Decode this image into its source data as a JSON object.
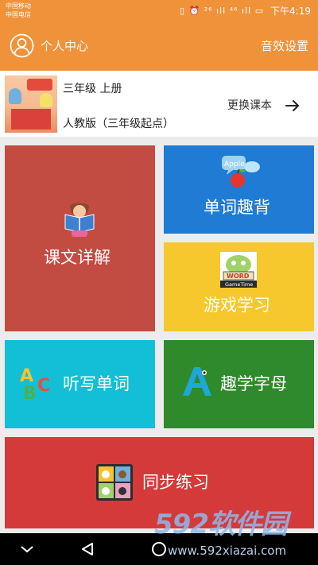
{
  "status_bar": {
    "carrier_1": "中国移动",
    "carrier_2": "中国电信",
    "icons": "▯ ⏰ ²⁶ ıll ⁴⁶ ıll ▭",
    "time": "下午4:19"
  },
  "header": {
    "title": "个人中心",
    "settings_label": "音效设置"
  },
  "book": {
    "grade": "三年级 上册",
    "edition": "人教版（三年级起点）",
    "change_label": "更换课本"
  },
  "tiles": {
    "kewen": "课文详解",
    "danci": "单词趣背",
    "youxi": "游戏学习",
    "tingxie": "听写单词",
    "zimu": "趣学字母",
    "tongbu": "同步练习"
  },
  "colors": {
    "header": "#f0923a",
    "kewen": "#c24c42",
    "danci": "#1f7bd4",
    "youxi": "#f7c72e",
    "tingxie": "#13bfd6",
    "zimu": "#2f8a2b",
    "tongbu": "#d43a3a"
  },
  "watermark": {
    "logo": "592软件园",
    "url": "www.592xiazai.com"
  }
}
